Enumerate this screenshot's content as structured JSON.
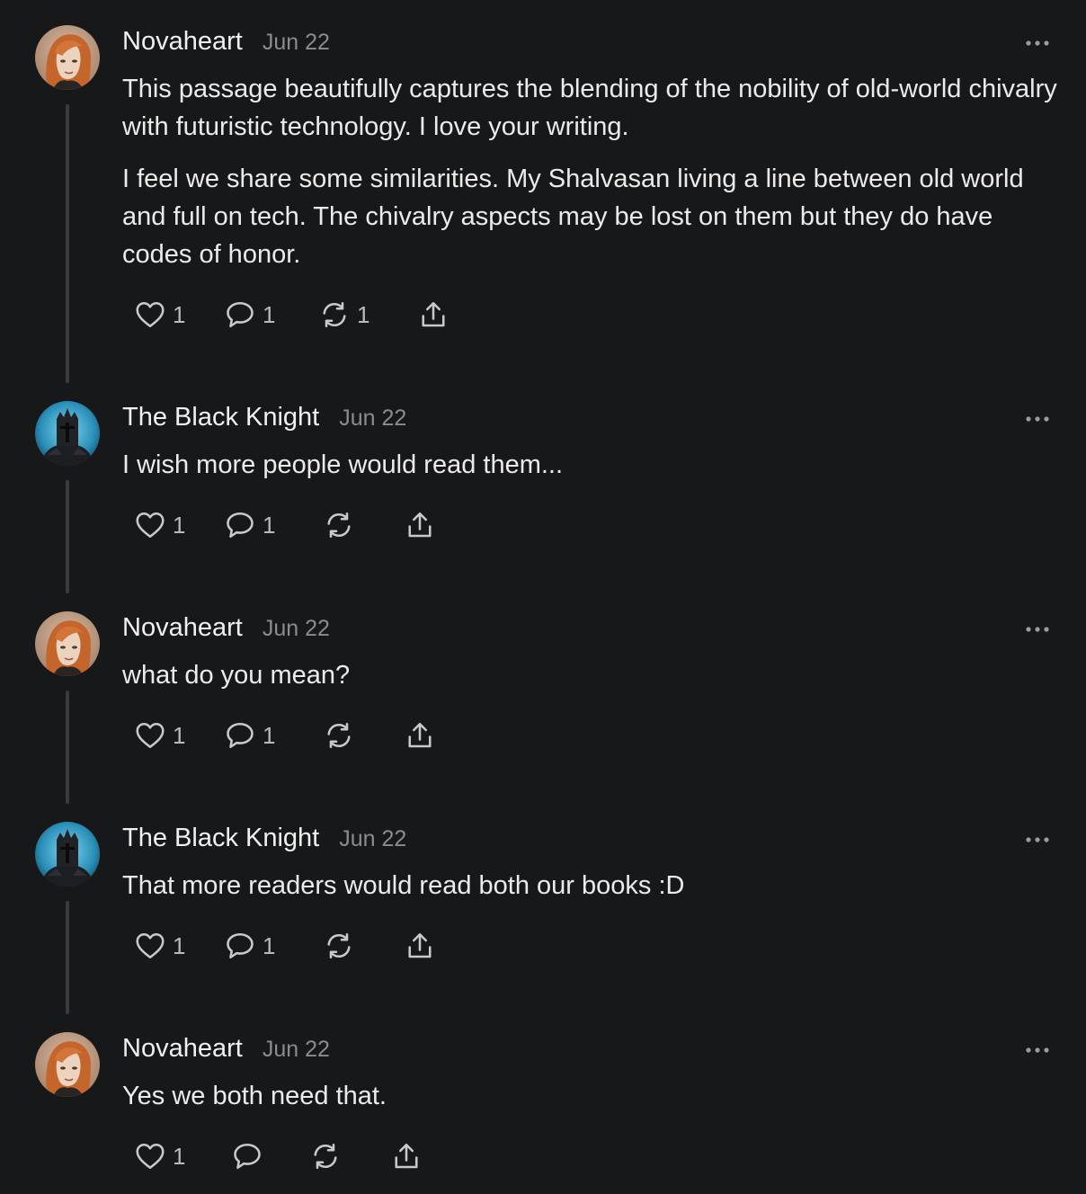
{
  "comments": [
    {
      "author": "Novaheart",
      "date": "Jun 22",
      "avatar_icon": "redhead-portrait-avatar",
      "paragraphs": [
        "This passage beautifully captures the blending of the nobility of old-world chivalry with futuristic technology. I love your writing.",
        "I feel we share some similarities. My Shalvasan living a line between old world and full on tech. The chivalry aspects may be lost on them but they do have codes of honor."
      ],
      "likes": "1",
      "replies": "1",
      "restacks": "1"
    },
    {
      "author": "The Black Knight",
      "date": "Jun 22",
      "avatar_icon": "black-knight-helmet-avatar",
      "paragraphs": [
        "I wish more people would read them..."
      ],
      "likes": "1",
      "replies": "1",
      "restacks": ""
    },
    {
      "author": "Novaheart",
      "date": "Jun 22",
      "avatar_icon": "redhead-portrait-avatar",
      "paragraphs": [
        "what do you mean?"
      ],
      "likes": "1",
      "replies": "1",
      "restacks": ""
    },
    {
      "author": "The Black Knight",
      "date": "Jun 22",
      "avatar_icon": "black-knight-helmet-avatar",
      "paragraphs": [
        "That more readers would read both our books :D"
      ],
      "likes": "1",
      "replies": "1",
      "restacks": ""
    },
    {
      "author": "Novaheart",
      "date": "Jun 22",
      "avatar_icon": "redhead-portrait-avatar",
      "paragraphs": [
        "Yes we both need that."
      ],
      "likes": "1",
      "replies": "",
      "restacks": ""
    }
  ],
  "icons": {
    "like": "heart-icon",
    "reply": "comment-bubble-icon",
    "restack": "restack-arrows-icon",
    "share": "share-upload-icon",
    "more": "more-options-icon"
  },
  "colors": {
    "background": "#17181a",
    "text": "#ebebeb",
    "muted": "#8b8c90",
    "thread_line": "#3a3b3e",
    "icon": "#c8c9cc"
  }
}
